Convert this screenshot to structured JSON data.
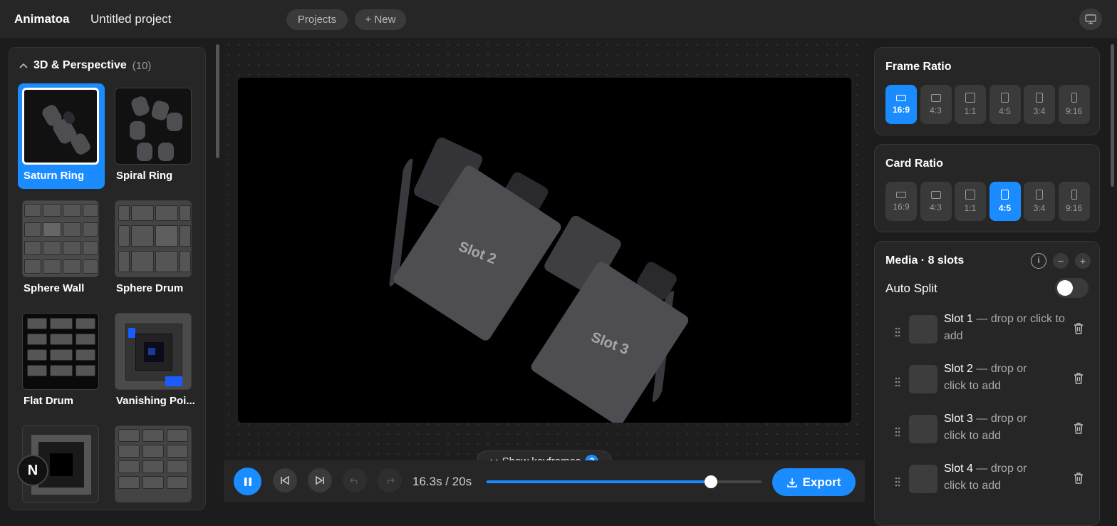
{
  "topbar": {
    "brand": "Animatoa",
    "project_name": "Untitled project",
    "projects_label": "Projects",
    "new_label": "+ New",
    "display_icon": "monitor-icon"
  },
  "library": {
    "category": "3D & Perspective",
    "count": "(10)",
    "tiles": [
      {
        "label": "Saturn Ring",
        "selected": true
      },
      {
        "label": "Spiral Ring",
        "selected": false
      },
      {
        "label": "Sphere Wall",
        "selected": false
      },
      {
        "label": "Sphere Drum",
        "selected": false
      },
      {
        "label": "Flat Drum",
        "selected": false
      },
      {
        "label": "Vanishing Poi...",
        "selected": false
      }
    ],
    "avatar_initial": "N"
  },
  "stage": {
    "card_labels": [
      "Slot 2",
      "Slot 3"
    ],
    "keyframes_label": "Show keyframes",
    "keyframes_count": "2"
  },
  "playback": {
    "time": "16.3s / 20s",
    "progress": 0.815,
    "export_label": "Export"
  },
  "frame_ratio": {
    "title": "Frame Ratio",
    "options": [
      "16:9",
      "4:3",
      "1:1",
      "4:5",
      "3:4",
      "9:16"
    ],
    "selected": "16:9"
  },
  "card_ratio": {
    "title": "Card Ratio",
    "options": [
      "16:9",
      "4:3",
      "1:1",
      "4:5",
      "3:4",
      "9:16"
    ],
    "selected": "4:5"
  },
  "media": {
    "title": "Media · 8 slots",
    "auto_split_label": "Auto Split",
    "auto_split_on": false,
    "slots": [
      {
        "name": "Slot 1",
        "hint": " — drop or click to add"
      },
      {
        "name": "Slot 2",
        "hint": " — drop or click to add"
      },
      {
        "name": "Slot 3",
        "hint": " — drop or click to add"
      },
      {
        "name": "Slot 4",
        "hint": " — drop or click to add"
      }
    ]
  },
  "colors": {
    "accent": "#1a8cff",
    "background": "#1c1c1c",
    "panel": "#262626"
  }
}
